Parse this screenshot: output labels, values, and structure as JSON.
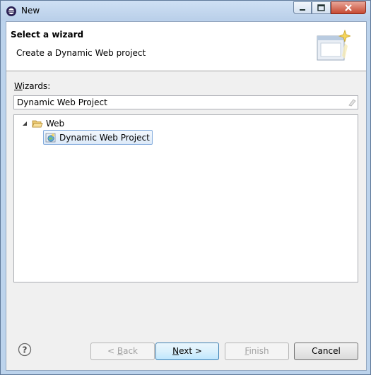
{
  "window": {
    "title": "New"
  },
  "header": {
    "title": "Select a wizard",
    "description": "Create a Dynamic Web project"
  },
  "wizards": {
    "label_prefix": "W",
    "label_rest": "izards:",
    "filter_value": "Dynamic Web Project",
    "tree": [
      {
        "label": "Web",
        "expanded": true,
        "icon": "folder-open-icon"
      },
      {
        "label": "Dynamic Web Project",
        "selected": true,
        "icon": "dynamic-web-project-icon"
      }
    ]
  },
  "buttons": {
    "back_prefix": "< ",
    "back_mnemonic": "B",
    "back_rest": "ack",
    "next_mnemonic": "N",
    "next_rest": "ext >",
    "finish_mnemonic": "F",
    "finish_rest": "inish",
    "cancel_label": "Cancel"
  },
  "colors": {
    "titlebar": "#bcd3ec",
    "default_button_border": "#3c7fb1",
    "selection_border": "#84acdd"
  }
}
